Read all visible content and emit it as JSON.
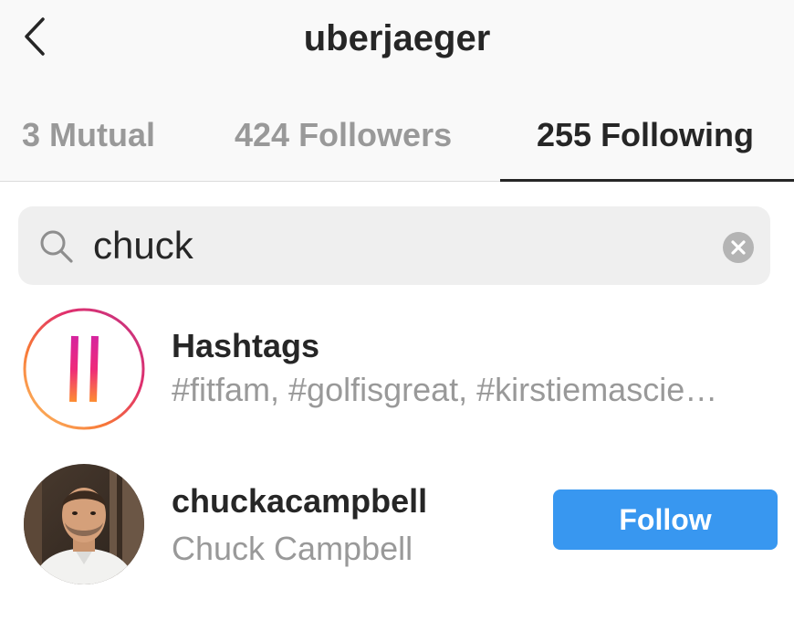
{
  "header": {
    "title": "uberjaeger",
    "back_icon": "chevron-left-icon"
  },
  "tabs": [
    {
      "label": "3 Mutual",
      "active": false
    },
    {
      "label": "424 Followers",
      "active": false
    },
    {
      "label": "255 Following",
      "active": true
    }
  ],
  "search": {
    "value": "chuck",
    "icon": "search-icon",
    "clear_icon": "clear-icon"
  },
  "results": [
    {
      "type": "hashtags",
      "title": "Hashtags",
      "subtitle": "#fitfam, #golfisgreat, #kirstiemascie…",
      "icon": "hashtag-icon"
    },
    {
      "type": "user",
      "username": "chuckacampbell",
      "full_name": "Chuck Campbell",
      "action_label": "Follow",
      "action_color": "#3897f0"
    }
  ],
  "colors": {
    "primary_text": "#262626",
    "secondary_text": "#999999",
    "accent": "#3897f0",
    "header_bg": "#f9f9f9"
  }
}
